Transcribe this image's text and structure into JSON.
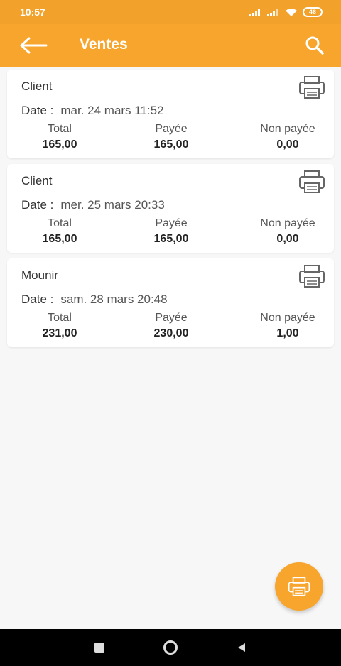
{
  "status_bar": {
    "time": "10:57",
    "battery": "48"
  },
  "app_bar": {
    "title": "Ventes",
    "back_icon": "arrow-left-icon",
    "search_icon": "search-icon"
  },
  "labels": {
    "date": "Date :",
    "total": "Total",
    "payee": "Payée",
    "non_payee": "Non payée"
  },
  "sales": [
    {
      "client": "Client",
      "date": "mar. 24 mars 11:52",
      "total": "165,00",
      "payee": "165,00",
      "non_payee": "0,00"
    },
    {
      "client": "Client",
      "date": "mer. 25 mars 20:33",
      "total": "165,00",
      "payee": "165,00",
      "non_payee": "0,00"
    },
    {
      "client": "Mounir",
      "date": "sam. 28 mars 20:48",
      "total": "231,00",
      "payee": "230,00",
      "non_payee": "1,00"
    }
  ],
  "colors": {
    "accent": "#f7a52c",
    "status_bar": "#f2a12a",
    "nav_bar": "#000000"
  }
}
